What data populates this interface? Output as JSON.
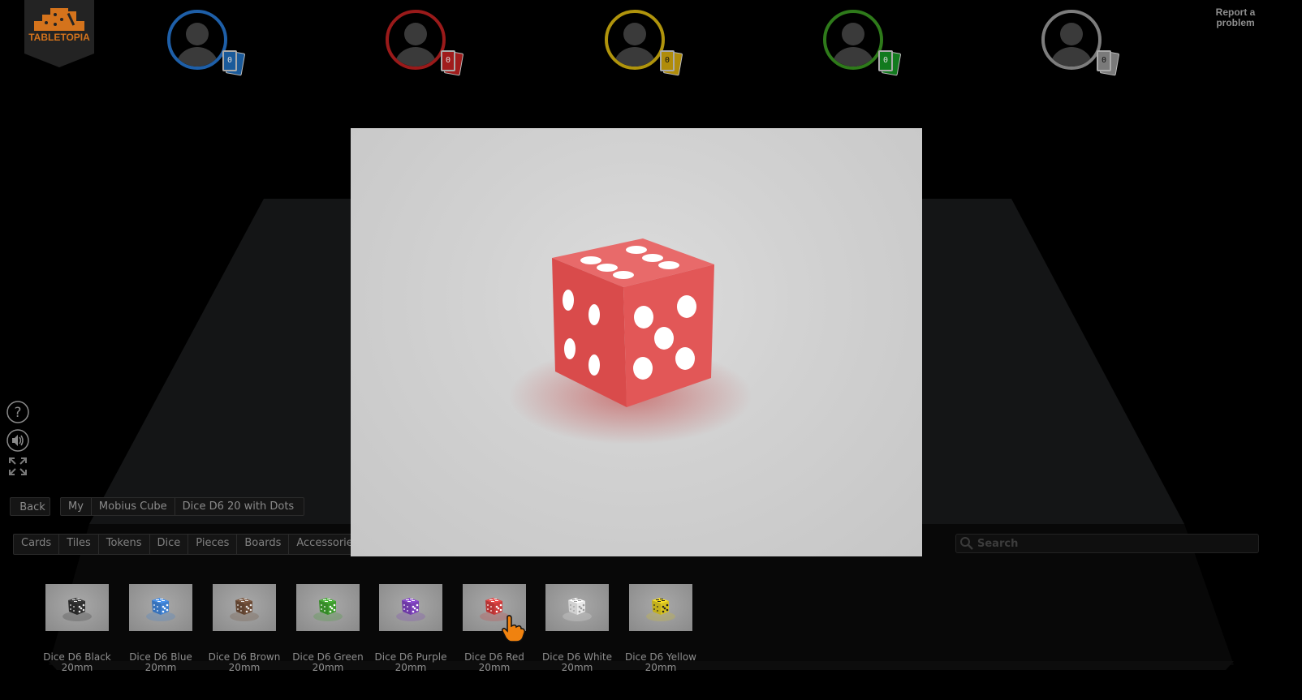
{
  "app": {
    "logo_text": "TABLETOPIA",
    "report_link": "Report a problem",
    "accent_color": "#e07a1c"
  },
  "players": [
    {
      "color_name": "blue",
      "color": "#1e5fa8",
      "badge_color": "#1a5a9a",
      "card_count": "0"
    },
    {
      "color_name": "red",
      "color": "#9a1a1a",
      "badge_color": "#a01c1c",
      "card_count": "0"
    },
    {
      "color_name": "yellow",
      "color": "#b0940c",
      "badge_color": "#b08c0a",
      "card_count": "0"
    },
    {
      "color_name": "green",
      "color": "#2e7a1a",
      "badge_color": "#127a1e",
      "card_count": "0"
    },
    {
      "color_name": "gray",
      "color": "#7d7d7d",
      "badge_color": "#7a7a7a",
      "card_count": "0"
    }
  ],
  "tools": [
    {
      "name": "help",
      "icon": "question-circle-icon"
    },
    {
      "name": "sound",
      "icon": "speaker-icon"
    },
    {
      "name": "fullscreen",
      "icon": "expand-icon"
    }
  ],
  "navigation": {
    "back_label": "Back",
    "breadcrumb": [
      "My",
      "Mobius Cube",
      "Dice D6 20 with Dots"
    ]
  },
  "categories": [
    "Cards",
    "Tiles",
    "Tokens",
    "Dice",
    "Pieces",
    "Boards",
    "Accessories"
  ],
  "search": {
    "placeholder": "Search",
    "value": ""
  },
  "preview": {
    "title": "Dice D6 Red 20mm",
    "die_color": "#d84a4a",
    "pip_color": "#ffffff"
  },
  "items": [
    {
      "name": "Dice D6 Black",
      "size": "20mm",
      "die_color": "#2e2e2e",
      "pip_color": "#e6e6e6"
    },
    {
      "name": "Dice D6 Blue",
      "size": "20mm",
      "die_color": "#3d7fd0",
      "pip_color": "#ffffff"
    },
    {
      "name": "Dice D6 Brown",
      "size": "20mm",
      "die_color": "#6b4a35",
      "pip_color": "#e6e6e6"
    },
    {
      "name": "Dice D6 Green",
      "size": "20mm",
      "die_color": "#3c9a2c",
      "pip_color": "#ffffff"
    },
    {
      "name": "Dice D6 Purple",
      "size": "20mm",
      "die_color": "#7a3fb8",
      "pip_color": "#ffffff"
    },
    {
      "name": "Dice D6 Red",
      "size": "20mm",
      "die_color": "#cc3b3b",
      "pip_color": "#ffffff"
    },
    {
      "name": "Dice D6 White",
      "size": "20mm",
      "die_color": "#e8e8e8",
      "pip_color": "#9a9a9a"
    },
    {
      "name": "Dice D6 Yellow",
      "size": "20mm",
      "die_color": "#d8c21e",
      "pip_color": "#222222"
    }
  ]
}
